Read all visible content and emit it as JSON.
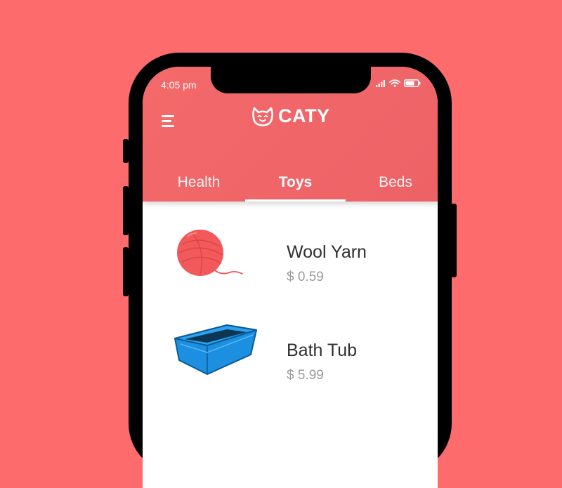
{
  "status_bar": {
    "time": "4:05 pm",
    "icons": [
      "signal-icon",
      "wifi-icon",
      "battery-icon"
    ]
  },
  "header": {
    "brand": "CATY",
    "logo_icon": "cat-face-icon",
    "menu_icon": "hamburger-menu-icon",
    "color": "#f06868"
  },
  "tabs": [
    {
      "label": "Health",
      "active": false
    },
    {
      "label": "Toys",
      "active": true
    },
    {
      "label": "Beds",
      "active": false
    }
  ],
  "products": [
    {
      "name": "Wool Yarn",
      "price": "$ 0.59",
      "icon": "yarn-ball-icon"
    },
    {
      "name": "Bath Tub",
      "price": "$ 5.99",
      "icon": "bath-tub-icon"
    }
  ],
  "colors": {
    "background": "#fd6b6c",
    "accent": "#f06868",
    "text_primary": "#2f2f2f",
    "text_secondary": "#9a9a9a"
  }
}
